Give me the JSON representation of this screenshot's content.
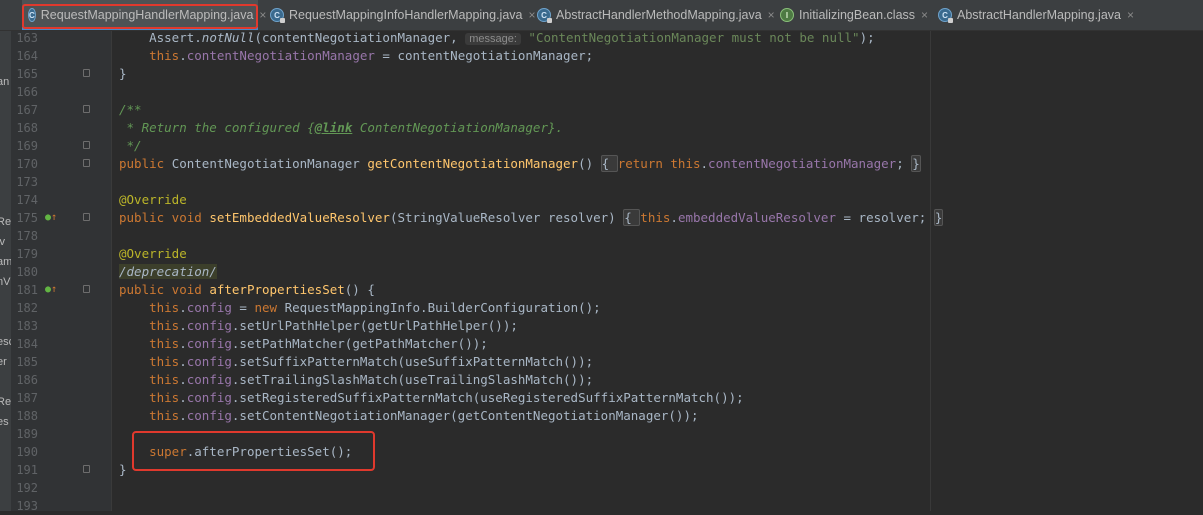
{
  "tabs": [
    {
      "label": "RequestMappingHandlerMapping.java",
      "icon": "class-icon",
      "active": true
    },
    {
      "label": "RequestMappingInfoHandlerMapping.java",
      "icon": "abstract-class-icon",
      "active": false
    },
    {
      "label": "AbstractHandlerMethodMapping.java",
      "icon": "abstract-class-icon",
      "active": false
    },
    {
      "label": "InitializingBean.class",
      "icon": "interface-icon",
      "active": false
    },
    {
      "label": "AbstractHandlerMapping.java",
      "icon": "abstract-class-icon",
      "active": false
    }
  ],
  "left_strip_fragments": [
    "an",
    "Re",
    "lv",
    "am",
    "nV",
    "esc",
    "er",
    "Re",
    "es"
  ],
  "lines": [
    {
      "num": "163",
      "fold": false,
      "mark": "",
      "tokens": [
        [
          "",
          "    Assert."
        ],
        [
          "it",
          "notNull"
        ],
        [
          "",
          "(contentNegotiationManager, "
        ],
        [
          "hint",
          "message:"
        ],
        [
          "str",
          " \"ContentNegotiationManager must not be null\""
        ],
        [
          "",
          ");"
        ]
      ]
    },
    {
      "num": "164",
      "fold": false,
      "mark": "",
      "tokens": [
        [
          "kw",
          "    this"
        ],
        [
          "",
          "."
        ],
        [
          "fld",
          "contentNegotiationManager"
        ],
        [
          "",
          " = contentNegotiationManager;"
        ]
      ]
    },
    {
      "num": "165",
      "fold": true,
      "mark": "",
      "tokens": [
        [
          "",
          "}"
        ]
      ]
    },
    {
      "num": "166",
      "fold": false,
      "mark": "",
      "tokens": []
    },
    {
      "num": "167",
      "fold": true,
      "mark": "",
      "tokens": [
        [
          "cmt",
          "/**"
        ]
      ]
    },
    {
      "num": "168",
      "fold": false,
      "mark": "",
      "tokens": [
        [
          "cmt",
          " * Return the configured {"
        ],
        [
          "link",
          "@link"
        ],
        [
          "cmt",
          " ContentNegotiationManager}."
        ]
      ]
    },
    {
      "num": "169",
      "fold": true,
      "mark": "",
      "tokens": [
        [
          "cmt",
          " */"
        ]
      ]
    },
    {
      "num": "170",
      "fold": true,
      "mark": "",
      "tokens": [
        [
          "kw",
          "public "
        ],
        [
          "",
          "ContentNegotiationManager "
        ],
        [
          "fn",
          "getContentNegotiationManager"
        ],
        [
          "",
          "() "
        ],
        [
          "fb",
          "{ "
        ],
        [
          "kw",
          "return this"
        ],
        [
          "",
          "."
        ],
        [
          "fld",
          "contentNegotiationManager"
        ],
        [
          "",
          "; "
        ],
        [
          "fb",
          "}"
        ]
      ]
    },
    {
      "num": "173",
      "fold": false,
      "mark": "",
      "tokens": []
    },
    {
      "num": "174",
      "fold": false,
      "mark": "",
      "tokens": [
        [
          "ann",
          "@Override"
        ]
      ]
    },
    {
      "num": "175",
      "fold": true,
      "mark": "override",
      "tokens": [
        [
          "kw",
          "public void "
        ],
        [
          "fn",
          "setEmbeddedValueResolver"
        ],
        [
          "",
          "(StringValueResolver resolver) "
        ],
        [
          "fb",
          "{ "
        ],
        [
          "kw",
          "this"
        ],
        [
          "",
          "."
        ],
        [
          "fld",
          "embeddedValueResolver"
        ],
        [
          "",
          " = resolver; "
        ],
        [
          "fb",
          "}"
        ]
      ]
    },
    {
      "num": "178",
      "fold": false,
      "mark": "",
      "tokens": []
    },
    {
      "num": "179",
      "fold": false,
      "mark": "",
      "tokens": [
        [
          "ann",
          "@Override"
        ]
      ]
    },
    {
      "num": "180",
      "fold": false,
      "mark": "",
      "tokens": [
        [
          "hl",
          "/deprecation/"
        ]
      ]
    },
    {
      "num": "181",
      "fold": true,
      "mark": "override",
      "tokens": [
        [
          "kw",
          "public void "
        ],
        [
          "fn",
          "afterPropertiesSet"
        ],
        [
          "",
          "() {"
        ]
      ]
    },
    {
      "num": "182",
      "fold": false,
      "mark": "",
      "tokens": [
        [
          "kw",
          "    this"
        ],
        [
          "",
          "."
        ],
        [
          "fld",
          "config"
        ],
        [
          "",
          " = "
        ],
        [
          "kw",
          "new "
        ],
        [
          "",
          "RequestMappingInfo.BuilderConfiguration();"
        ]
      ]
    },
    {
      "num": "183",
      "fold": false,
      "mark": "",
      "tokens": [
        [
          "kw",
          "    this"
        ],
        [
          "",
          "."
        ],
        [
          "fld",
          "config"
        ],
        [
          "",
          ".setUrlPathHelper(getUrlPathHelper());"
        ]
      ]
    },
    {
      "num": "184",
      "fold": false,
      "mark": "",
      "tokens": [
        [
          "kw",
          "    this"
        ],
        [
          "",
          "."
        ],
        [
          "fld",
          "config"
        ],
        [
          "",
          ".setPathMatcher(getPathMatcher());"
        ]
      ]
    },
    {
      "num": "185",
      "fold": false,
      "mark": "",
      "tokens": [
        [
          "kw",
          "    this"
        ],
        [
          "",
          "."
        ],
        [
          "fld",
          "config"
        ],
        [
          "",
          ".setSuffixPatternMatch(useSuffixPatternMatch());"
        ]
      ]
    },
    {
      "num": "186",
      "fold": false,
      "mark": "",
      "tokens": [
        [
          "kw",
          "    this"
        ],
        [
          "",
          "."
        ],
        [
          "fld",
          "config"
        ],
        [
          "",
          ".setTrailingSlashMatch(useTrailingSlashMatch());"
        ]
      ]
    },
    {
      "num": "187",
      "fold": false,
      "mark": "",
      "tokens": [
        [
          "kw",
          "    this"
        ],
        [
          "",
          "."
        ],
        [
          "fld",
          "config"
        ],
        [
          "",
          ".setRegisteredSuffixPatternMatch(useRegisteredSuffixPatternMatch());"
        ]
      ]
    },
    {
      "num": "188",
      "fold": false,
      "mark": "",
      "tokens": [
        [
          "kw",
          "    this"
        ],
        [
          "",
          "."
        ],
        [
          "fld",
          "config"
        ],
        [
          "",
          ".setContentNegotiationManager(getContentNegotiationManager());"
        ]
      ]
    },
    {
      "num": "189",
      "fold": false,
      "mark": "",
      "tokens": []
    },
    {
      "num": "190",
      "fold": false,
      "mark": "",
      "tokens": [
        [
          "kw",
          "    super"
        ],
        [
          "",
          ".afterPropertiesSet();"
        ]
      ]
    },
    {
      "num": "191",
      "fold": true,
      "mark": "",
      "tokens": [
        [
          "",
          "}"
        ]
      ]
    },
    {
      "num": "192",
      "fold": false,
      "mark": "",
      "tokens": []
    },
    {
      "num": "193",
      "fold": false,
      "mark": "",
      "tokens": []
    }
  ],
  "colors": {
    "keyword": "#cc7832",
    "method": "#ffc66d",
    "field": "#9876aa",
    "string": "#6a8759",
    "comment": "#629755",
    "annotation": "#bbb529",
    "highlight_box": "#e0392d",
    "background": "#2b2b2b"
  }
}
